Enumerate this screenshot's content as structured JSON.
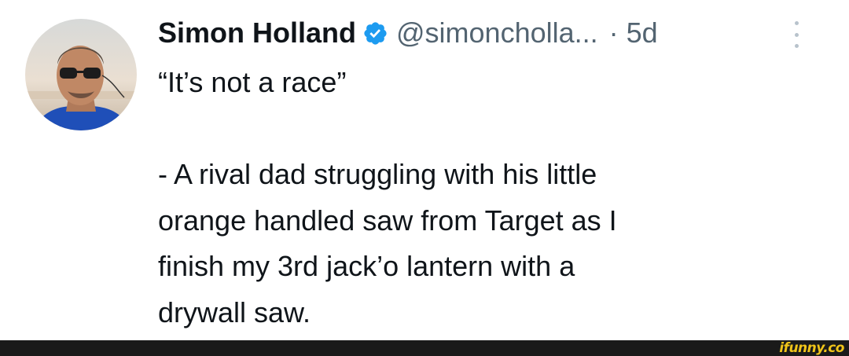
{
  "tweet": {
    "author_name": "Simon Holland",
    "handle": "@simoncholla...",
    "separator": "·",
    "time": "5d",
    "text": "“It’s not a race”\n\n- A rival dad struggling with his little\norange handled saw from Target as I\nfinish my 3rd jack’o lantern with a\ndrywall saw.",
    "avatar_icon": "user-avatar-photo",
    "verified_icon": "verified-badge-icon",
    "more_icon": "more-options-icon"
  },
  "footer": {
    "watermark": "ifunny.co"
  },
  "colors": {
    "verified": "#1d9bf0",
    "secondary_text": "#536471",
    "primary_text": "#0f1419",
    "watermark": "#f0c419",
    "footer_bar": "#1a1a1a"
  }
}
